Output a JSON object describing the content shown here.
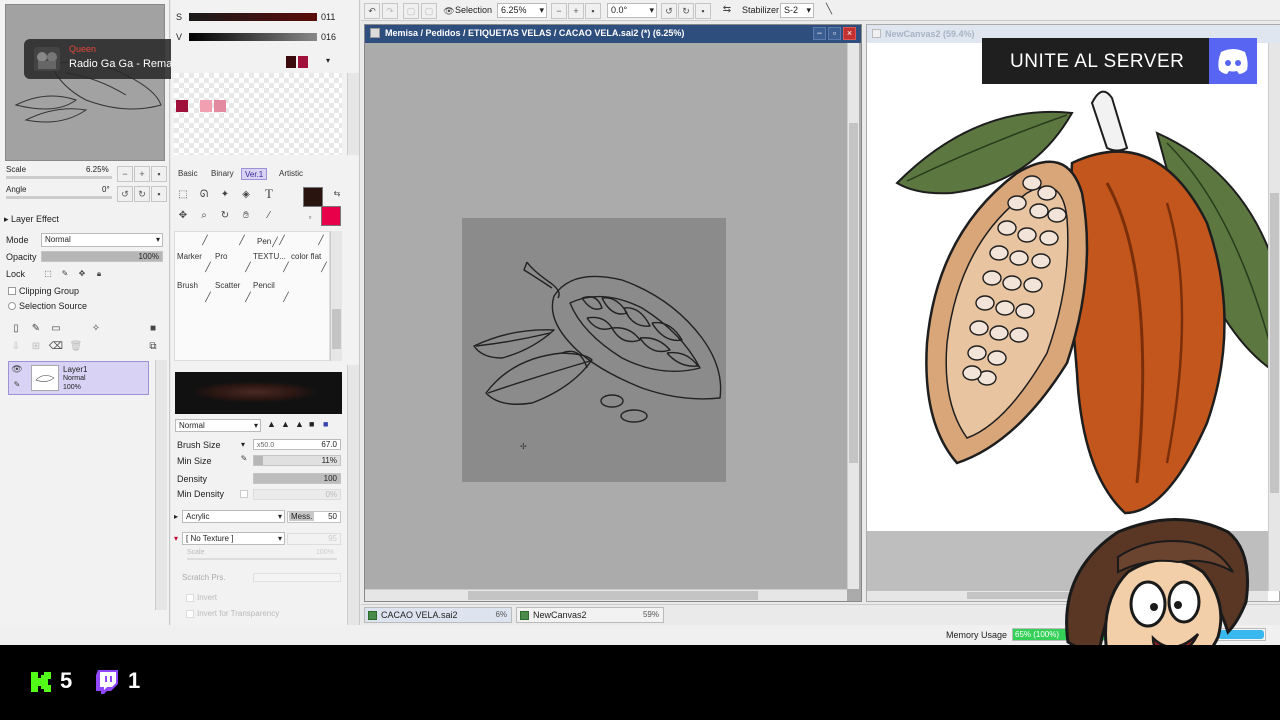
{
  "toolbar": {
    "selection_label": "Selection",
    "zoom_value": "6.25%",
    "angle_value": "0.0°",
    "stabilizer_label": "Stabilizer",
    "stabilizer_value": "S-2"
  },
  "media": {
    "artist": "Queen",
    "title": "Radio Ga Ga - Remast..."
  },
  "navigator": {
    "scale_label": "Scale",
    "scale_value": "6.25%",
    "angle_label": "Angle",
    "angle_value": "0°"
  },
  "color": {
    "s_label": "S",
    "s_value": "011",
    "v_label": "V",
    "v_value": "016",
    "primary": "#2a1410",
    "secondary": "#e8004a",
    "swatches": [
      "#3a0a0c",
      "#a0103a",
      "#e38aa0",
      "#f0a0b0"
    ]
  },
  "layer": {
    "effect_label": "Layer Effect",
    "mode_label": "Mode",
    "mode_value": "Normal",
    "opacity_label": "Opacity",
    "opacity_value": "100%",
    "opacity": 1.0,
    "lock_label": "Lock",
    "clipping_label": "Clipping Group",
    "selection_source_label": "Selection Source",
    "item_name": "Layer1",
    "item_mode": "Normal",
    "item_opacity": "100%"
  },
  "tool_tabs": [
    "Basic",
    "Binary",
    "Ver.1",
    "Artistic"
  ],
  "brushes": [
    {
      "label": "Pen"
    },
    {
      "label": "Marker"
    },
    {
      "label": "Pro"
    },
    {
      "label": "TEXTU..."
    },
    {
      "label": "color flat"
    },
    {
      "label": "Brush"
    },
    {
      "label": "Scatter"
    },
    {
      "label": "Pencil"
    }
  ],
  "brush_settings": {
    "blend_mode": "Normal",
    "size_label": "Brush Size",
    "size_mult": "x50.0",
    "size_value": "67.0",
    "min_size_label": "Min Size",
    "min_size_value": "11%",
    "min_size": 0.11,
    "density_label": "Density",
    "density_value": "100",
    "min_density_label": "Min Density",
    "min_density_value": "0%",
    "paper_label": "Acrylic",
    "mess_label": "Mess.",
    "mess_value": "50",
    "texture_label": "[ No Texture ]",
    "texture_strength": "95",
    "scale_label": "Scale",
    "scale_value": "100%",
    "scratch_label": "Scratch Prs.",
    "invert_label": "Invert",
    "invert_transparency_label": "Invert for Transparency"
  },
  "canvas_window": {
    "title": "Memisa / Pedidos / ETIQUETAS VELAS / CACAO VELA.sai2 (*) (6.25%)"
  },
  "ref_window": {
    "title": "NewCanvas2 (59.4%)"
  },
  "overlay": {
    "server_text": "UNITE AL SERVER"
  },
  "doc_tabs": [
    {
      "name": "CACAO VELA.sai2",
      "zoom": "6%"
    },
    {
      "name": "NewCanvas2",
      "zoom": "59%"
    }
  ],
  "memory": {
    "label": "Memory Usage",
    "value": "65% (100%)",
    "fraction": 0.65
  },
  "stream": {
    "kick_count": "5",
    "twitch_count": "1",
    "kick_color": "#53fc18",
    "twitch_color": "#9146ff"
  }
}
